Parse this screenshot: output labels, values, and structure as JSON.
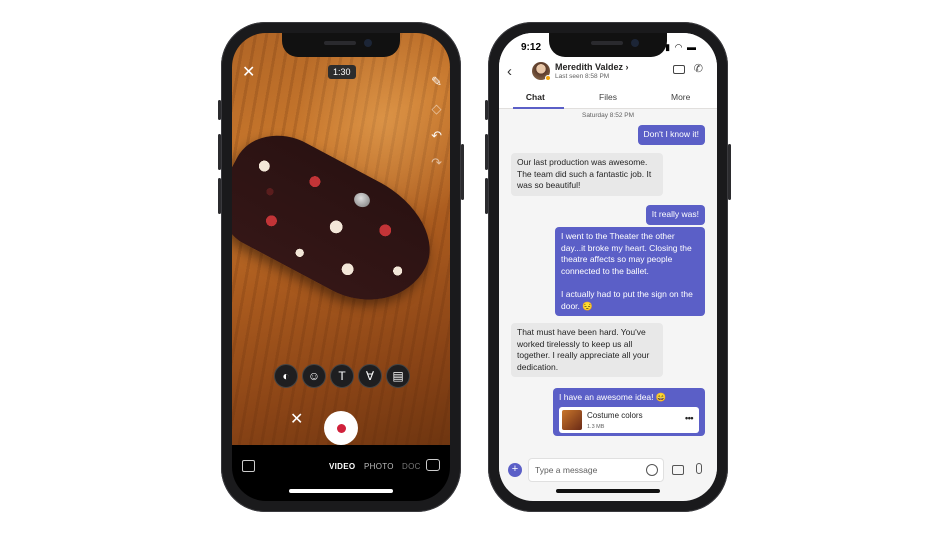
{
  "camera": {
    "close_icon": "✕",
    "timer": "1:30",
    "tools": [
      "pen-icon",
      "eraser-icon",
      "undo-icon",
      "redo-icon"
    ],
    "edit_tools": [
      "filter-icon",
      "sticker-icon",
      "text-icon",
      "draw-icon",
      "board-icon"
    ],
    "edit_glyphs": [
      "◐",
      "☺",
      "T",
      "∀",
      "▤"
    ],
    "cancel_icon": "✕",
    "modes": {
      "video": "VIDEO",
      "photo": "PHOTO",
      "doc": "DOC"
    }
  },
  "chat": {
    "status": {
      "time": "9:12"
    },
    "contact": {
      "name": "Meredith Valdez ›",
      "last_seen": "Last seen 8:58 PM"
    },
    "tabs": [
      "Chat",
      "Files",
      "More"
    ],
    "timestamp": "Saturday 8:52 PM",
    "messages": [
      {
        "dir": "out",
        "text": "Don't I know it!"
      },
      {
        "dir": "in",
        "text": "Our last production was awesome. The team did such a fantastic job. It was so beautiful!"
      },
      {
        "dir": "out",
        "text": "It really was!"
      },
      {
        "dir": "out",
        "text": "I went to the Theater the other day...it broke my heart. Closing the theatre affects so may people connected to the ballet.",
        "text2": "I actually had to put the sign on the door. 😔"
      },
      {
        "dir": "in",
        "text": "That must have been hard. You've worked tirelessly to keep us all together. I really appreciate all your  dedication."
      },
      {
        "dir": "out",
        "text": "I have an awesome idea! 😄",
        "file": {
          "name": "Costume colors",
          "size": "1.3 MB",
          "more": "•••"
        }
      }
    ],
    "compose": {
      "placeholder": "Type a message",
      "plus": "+"
    }
  }
}
